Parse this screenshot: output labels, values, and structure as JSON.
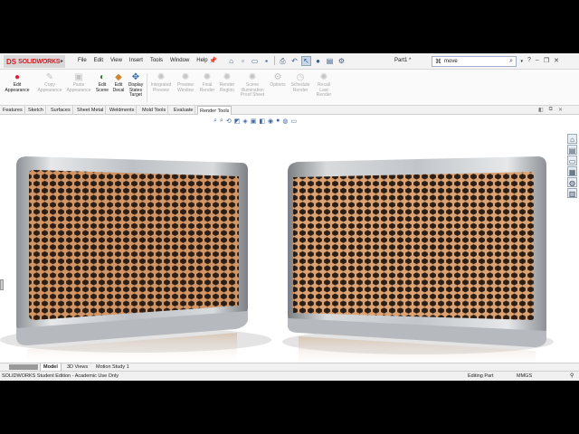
{
  "app": {
    "logo_text": "SOLIDWORKS",
    "logo_mark": "DS",
    "menu": [
      "File",
      "Edit",
      "View",
      "Insert",
      "Tools",
      "Window",
      "Help"
    ],
    "document_title": "Part1 *",
    "search_value": "move"
  },
  "ribbon": {
    "buttons": [
      {
        "label": "Edit\nAppearance",
        "enabled": true,
        "icon": "appearance-icon"
      },
      {
        "label": "Copy\nAppearance",
        "enabled": false,
        "icon": "copy-appearance-icon"
      },
      {
        "label": "Paste\nAppearance",
        "enabled": false,
        "icon": "paste-appearance-icon"
      },
      {
        "label": "Edit\nScene",
        "enabled": true,
        "icon": "scene-icon"
      },
      {
        "label": "Edit\nDecal",
        "enabled": true,
        "icon": "decal-icon"
      },
      {
        "label": "Display\nStates\nTarget",
        "enabled": true,
        "icon": "display-states-icon"
      },
      {
        "label": "Integrated\nPreview",
        "enabled": false,
        "icon": "integrated-preview-icon"
      },
      {
        "label": "Preview\nWindow",
        "enabled": false,
        "icon": "preview-window-icon"
      },
      {
        "label": "Final\nRender",
        "enabled": false,
        "icon": "final-render-icon"
      },
      {
        "label": "Render\nRegion",
        "enabled": false,
        "icon": "render-region-icon"
      },
      {
        "label": "Scene\nIllumination\nProof Sheet",
        "enabled": false,
        "icon": "illumination-icon"
      },
      {
        "label": "Options",
        "enabled": false,
        "icon": "options-icon"
      },
      {
        "label": "Schedule\nRender",
        "enabled": false,
        "icon": "schedule-render-icon"
      },
      {
        "label": "Recall\nLast\nRender",
        "enabled": false,
        "icon": "recall-render-icon"
      }
    ]
  },
  "tabs": [
    "Features",
    "Sketch",
    "Surfaces",
    "Sheet Metal",
    "Weldments",
    "Mold Tools",
    "Evaluate",
    "Render Tools"
  ],
  "active_tab": "Render Tools",
  "bottom_tabs": [
    "Model",
    "3D Views",
    "Motion Study 1"
  ],
  "active_bottom_tab": "Model",
  "status": {
    "edition": "SOLIDWORKS Student Edition - Academic Use Only",
    "mode": "Editing Part",
    "units": "MMGS",
    "help_icon": "help-icon"
  },
  "colors": {
    "brand": "#d71920",
    "mesh": "#c98a55",
    "frame": "#b9bcbf"
  }
}
